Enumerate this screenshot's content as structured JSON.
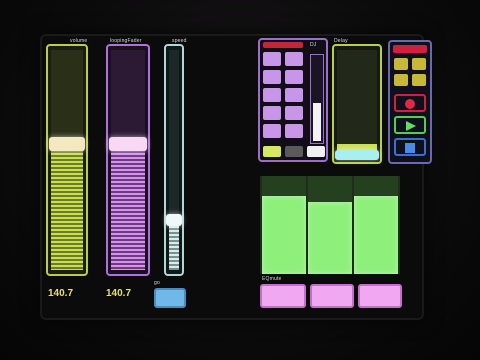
{
  "faders": {
    "left": {
      "label": "volume",
      "value": "140.7",
      "color": "#c8e050",
      "level": 0.68
    },
    "mid": {
      "label": "loopingFader",
      "value": "140.7",
      "color": "#d890f0",
      "level": 0.68
    },
    "narrow": {
      "label": "speed",
      "color": "#d8ecec",
      "level": 0.3
    }
  },
  "go_label": "go",
  "pad_panel": {
    "label": "DJ"
  },
  "delay_fader": {
    "label": "Delay",
    "color": "#d0e070",
    "level": 0.12
  },
  "transport": {
    "record_icon": "record-icon",
    "play_icon": "play-icon",
    "stop_icon": "stop-icon"
  },
  "eq": {
    "label": "EQmute",
    "levels": [
      0.78,
      0.72,
      0.78
    ]
  },
  "colors": {
    "lime": "#c8e050",
    "purple": "#c080f0",
    "green": "#8ef07a",
    "pink": "#f0a8f0",
    "red": "#d02040"
  }
}
